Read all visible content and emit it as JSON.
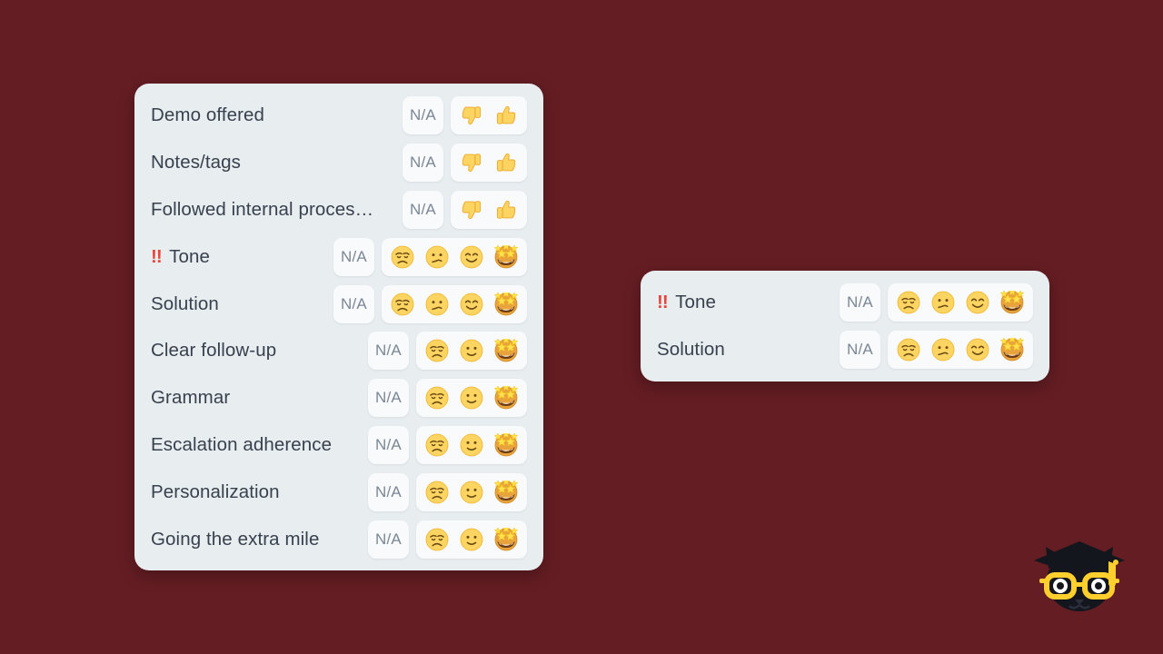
{
  "theme": {
    "background_color": "#641d23",
    "card_color": "#e8edf0",
    "pill_color": "#f8fafb",
    "label_color": "#38414d",
    "na_label_color": "#7b8795",
    "required_marker_color": "#e8453c"
  },
  "na_label": "N/A",
  "required_marker": "!!",
  "cards": [
    {
      "name": "scorecard-full",
      "rows": [
        {
          "label": "Demo offered",
          "required": false,
          "na": "N/A",
          "scale": "thumbs",
          "options": [
            "thumbs-down-icon",
            "thumbs-up-icon"
          ]
        },
        {
          "label": "Notes/tags",
          "required": false,
          "na": "N/A",
          "scale": "thumbs",
          "options": [
            "thumbs-down-icon",
            "thumbs-up-icon"
          ]
        },
        {
          "label": "Followed internal proces…",
          "required": false,
          "na": "N/A",
          "scale": "thumbs",
          "options": [
            "thumbs-down-icon",
            "thumbs-up-icon"
          ]
        },
        {
          "label": "Tone",
          "required": true,
          "na": "N/A",
          "scale": "four",
          "options": [
            "disappointed-face-icon",
            "confused-face-icon",
            "smiling-face-icon",
            "star-struck-face-icon"
          ]
        },
        {
          "label": "Solution",
          "required": false,
          "na": "N/A",
          "scale": "four",
          "options": [
            "disappointed-face-icon",
            "confused-face-icon",
            "smiling-face-icon",
            "star-struck-face-icon"
          ]
        },
        {
          "label": "Clear follow-up",
          "required": false,
          "na": "N/A",
          "scale": "three",
          "options": [
            "disappointed-face-icon",
            "slightly-smiling-face-icon",
            "star-struck-face-icon"
          ]
        },
        {
          "label": "Grammar",
          "required": false,
          "na": "N/A",
          "scale": "three",
          "options": [
            "disappointed-face-icon",
            "slightly-smiling-face-icon",
            "star-struck-face-icon"
          ]
        },
        {
          "label": "Escalation adherence",
          "required": false,
          "na": "N/A",
          "scale": "three",
          "options": [
            "disappointed-face-icon",
            "slightly-smiling-face-icon",
            "star-struck-face-icon"
          ]
        },
        {
          "label": "Personalization",
          "required": false,
          "na": "N/A",
          "scale": "three",
          "options": [
            "disappointed-face-icon",
            "slightly-smiling-face-icon",
            "star-struck-face-icon"
          ]
        },
        {
          "label": "Going the extra mile",
          "required": false,
          "na": "N/A",
          "scale": "three",
          "options": [
            "disappointed-face-icon",
            "slightly-smiling-face-icon",
            "star-struck-face-icon"
          ]
        }
      ]
    },
    {
      "name": "scorecard-compact",
      "rows": [
        {
          "label": "Tone",
          "required": true,
          "na": "N/A",
          "scale": "four",
          "options": [
            "disappointed-face-icon",
            "confused-face-icon",
            "smiling-face-icon",
            "star-struck-face-icon"
          ]
        },
        {
          "label": "Solution",
          "required": false,
          "na": "N/A",
          "scale": "four",
          "options": [
            "disappointed-face-icon",
            "confused-face-icon",
            "smiling-face-icon",
            "star-struck-face-icon"
          ]
        }
      ]
    }
  ],
  "logo": {
    "name": "graduate-cat-logo",
    "cap_color": "#14161d",
    "tassel_color": "#ffcf2e",
    "glasses_color": "#ffcf2e",
    "face_color": "#14161d"
  }
}
